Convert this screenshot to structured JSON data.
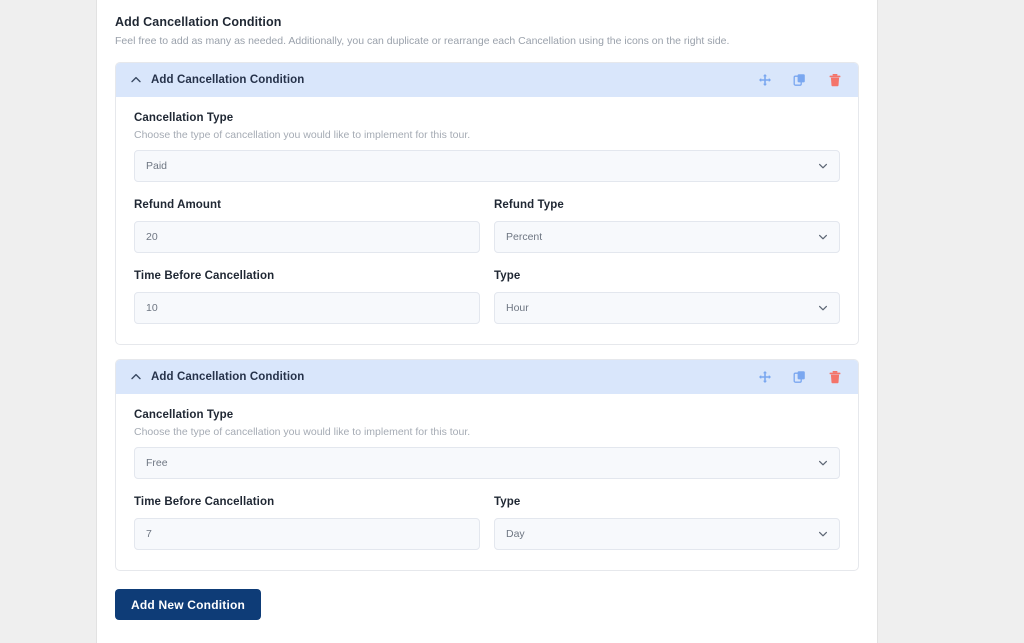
{
  "section": {
    "title": "Add Cancellation Condition",
    "description": "Feel free to add as many as needed. Additionally, you can duplicate or rearrange each Cancellation using the icons on the right side."
  },
  "icons": {
    "collapse": "chevron-up-icon",
    "move": "move-icon",
    "duplicate": "duplicate-icon",
    "delete": "trash-icon",
    "dropdown": "chevron-down-icon"
  },
  "colors": {
    "panel_header_bg": "#d9e6fb",
    "action_blue": "#7aa7f0",
    "action_red": "#f4746a",
    "button_navy": "#0e3c77",
    "field_bg": "#f7f9fc"
  },
  "conditions": [
    {
      "header_title": "Add Cancellation Condition",
      "cancellation_type": {
        "label": "Cancellation Type",
        "help": "Choose the type of cancellation you would like to implement for this tour.",
        "value": "Paid"
      },
      "refund_amount": {
        "label": "Refund Amount",
        "value": "20"
      },
      "refund_type": {
        "label": "Refund Type",
        "value": "Percent"
      },
      "time_before": {
        "label": "Time Before Cancellation",
        "value": "10"
      },
      "time_type": {
        "label": "Type",
        "value": "Hour"
      }
    },
    {
      "header_title": "Add Cancellation Condition",
      "cancellation_type": {
        "label": "Cancellation Type",
        "help": "Choose the type of cancellation you would like to implement for this tour.",
        "value": "Free"
      },
      "time_before": {
        "label": "Time Before Cancellation",
        "value": "7"
      },
      "time_type": {
        "label": "Type",
        "value": "Day"
      }
    }
  ],
  "add_button": {
    "label": "Add New Condition"
  }
}
